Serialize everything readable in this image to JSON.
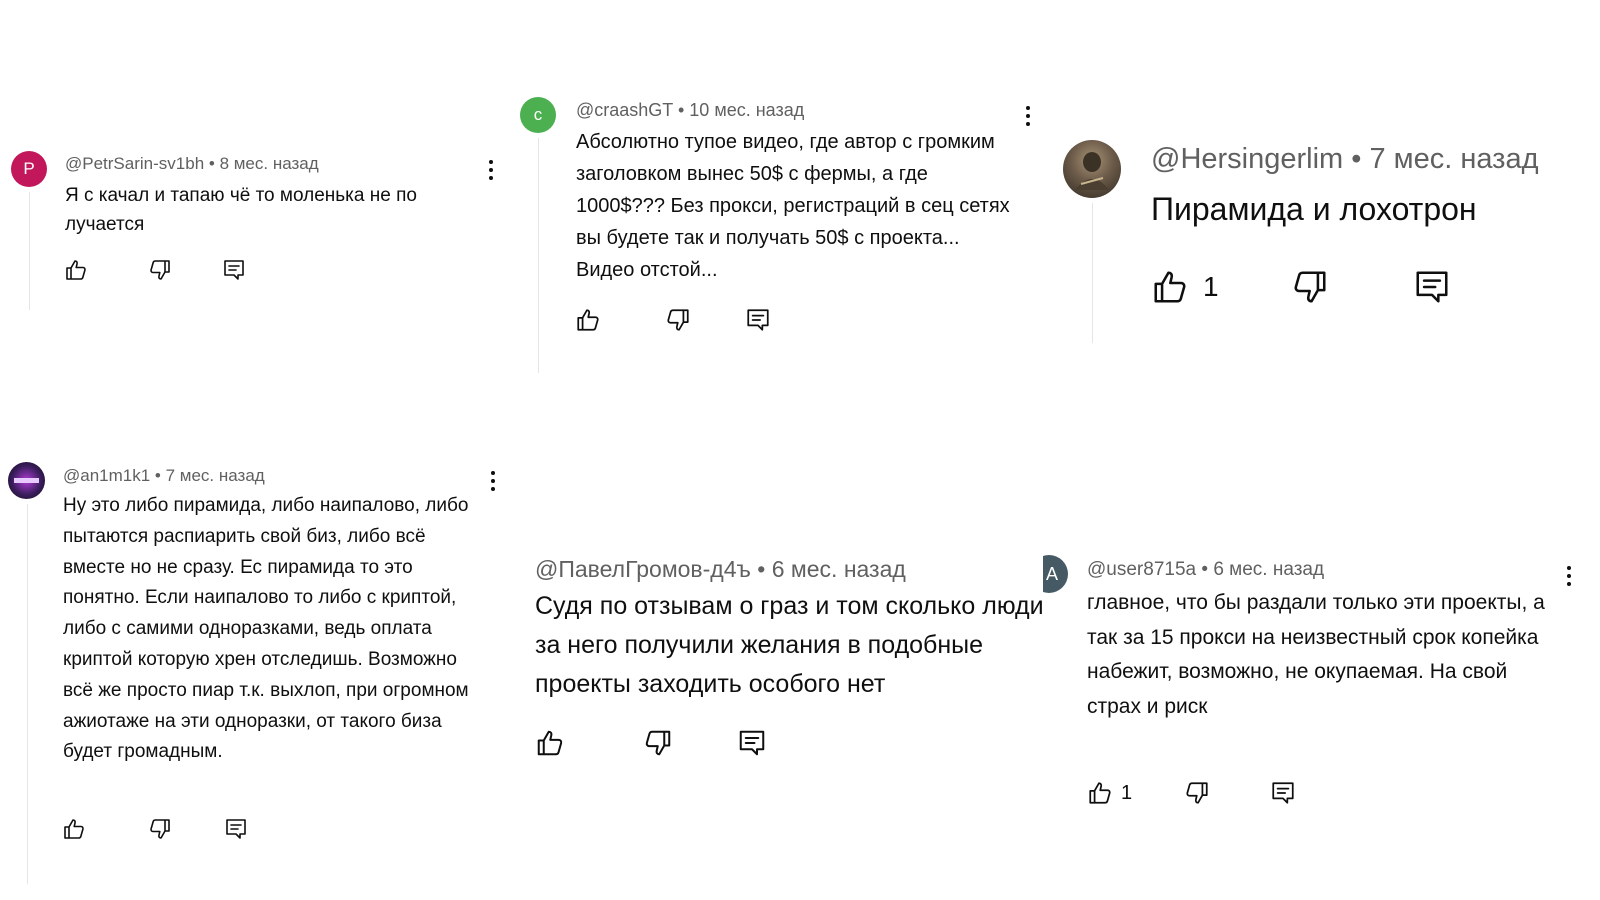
{
  "colors": {
    "meta_text": "#606060",
    "body_text": "#0f0f0f",
    "thread_line": "#e5e5e5",
    "icon_stroke": "#0f0f0f"
  },
  "comments": [
    {
      "avatar": {
        "letter": "P",
        "color": "#c2185b"
      },
      "author": "@PetrSarin-sv1bh",
      "time": "8 мес. назад",
      "text": "Я с качал и тапаю чё то моленька не по лучается",
      "likes": ""
    },
    {
      "avatar": {
        "letter": "c",
        "color": "#4caf50"
      },
      "author": "@craashGT",
      "time": "10 мес. назад",
      "text": "Абсолютно тупое видео, где автор с громким заголовком вынес 50$ с фермы, а где 1000$??? Без прокси, регистраций в сец сетях вы будете так и получать 50$ с проекта... Видео отстой...",
      "likes": ""
    },
    {
      "avatar": {
        "letter": "",
        "color": "#6b5a48",
        "icon": "photo-avatar"
      },
      "author": "@Hersingerlim",
      "time": "7 мес. назад",
      "text": "Пирамида и лохотрон",
      "likes": "1"
    },
    {
      "avatar": {
        "letter": "",
        "color": "#3a1d5c",
        "icon": "photo-avatar"
      },
      "author": "@an1m1k1",
      "time": "7 мес. назад",
      "text": "Ну это либо пирамида, либо наипалово, либо пытаются распиарить свой биз, либо всё вместе но не сразу. Ес пирамида то это понятно. Если наипалово то либо с криптой, либо с самими одноразками, ведь оплата криптой которую хрен отследишь. Возможно всё же просто пиар т.к. выхлоп, при огромном ажиотаже на эти одноразки, от такого биза будет громадным.",
      "likes": ""
    },
    {
      "avatar": null,
      "author": "@ПавелГромов-д4ъ",
      "time": "6 мес. назад",
      "text": "Судя по отзывам о граз и том сколько люди за него получили желания в подобные проекты заходить особого нет",
      "likes": ""
    },
    {
      "avatar": {
        "letter": "A",
        "color": "#455a64"
      },
      "author": "@user8715a",
      "time": "6 мес. назад",
      "text": "главное, что бы раздали только эти проекты, а так за 15 прокси на неизвестный срок копейка набежит, возможно, не окупаемая. На свой страх и риск",
      "likes": "1"
    }
  ],
  "separator": " • "
}
